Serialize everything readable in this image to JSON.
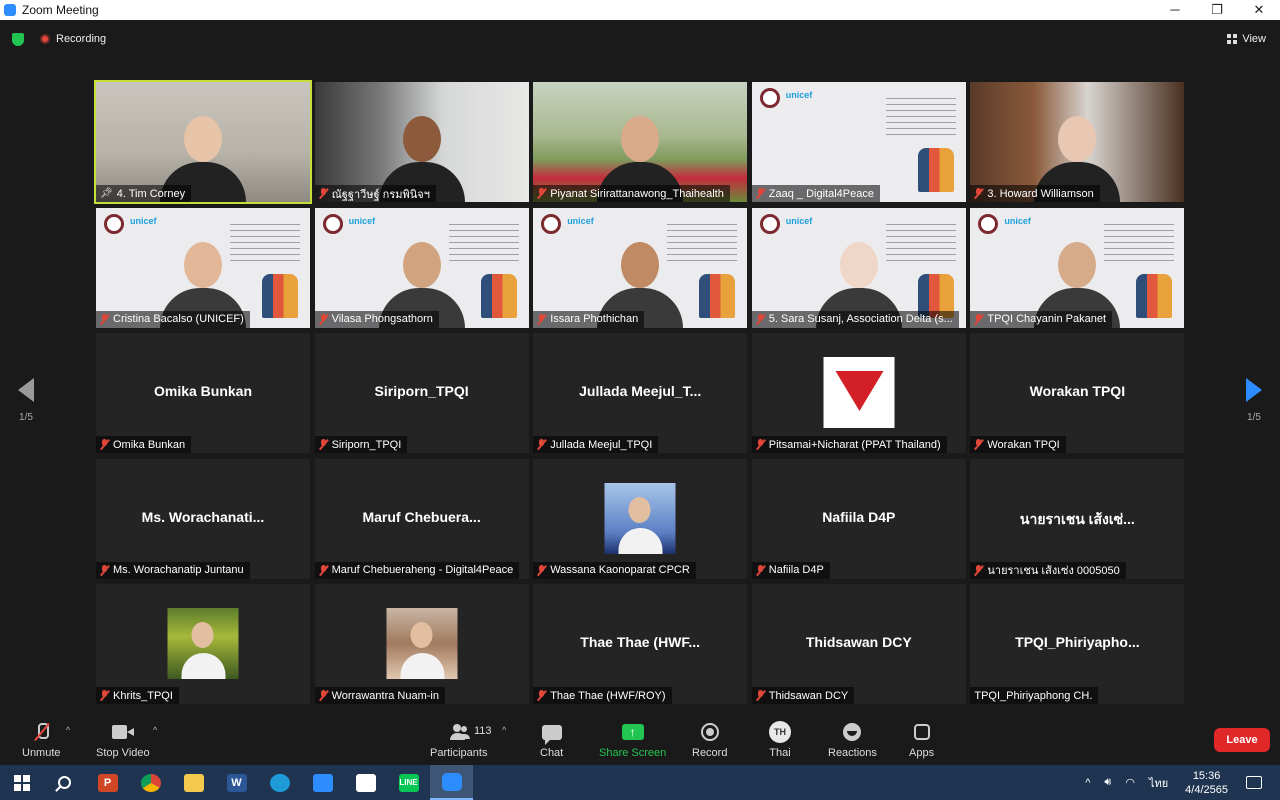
{
  "window": {
    "title": "Zoom Meeting",
    "minimize": "─",
    "restore": "❐",
    "close": "✕"
  },
  "topbar": {
    "recording_label": "Recording",
    "view_label": "View"
  },
  "colors": {
    "active_speaker": "#c6de3a",
    "muted": "#e0473a",
    "share": "#23c552",
    "leave": "#e02828",
    "accent": "#2d8cff"
  },
  "tiles": [
    {
      "label": "4. Tim Corney",
      "bigname": "",
      "video": "room",
      "active": true,
      "pinned": true,
      "muted": false
    },
    {
      "label": "ณัฐฐาวีษฐ์ กรมพินิจฯ",
      "bigname": "",
      "video": "office",
      "muted": true
    },
    {
      "label": "Piyanat Sirirattanawong_Thaihealth",
      "bigname": "",
      "video": "outdoor",
      "muted": true
    },
    {
      "label": "Zaaq _ Digital4Peace",
      "bigname": "",
      "video": "slide",
      "muted": true
    },
    {
      "label": "3. Howard Williamson",
      "bigname": "",
      "video": "books",
      "muted": true
    },
    {
      "label": "Cristina Bacalso (UNICEF)",
      "bigname": "",
      "video": "slide-person",
      "muted": true
    },
    {
      "label": "Vilasa Phongsathorn",
      "bigname": "",
      "video": "slide-person",
      "muted": true
    },
    {
      "label": "Issara Phothichan",
      "bigname": "",
      "video": "slide-person",
      "muted": true
    },
    {
      "label": "5. Sara Susanj, Association Delta (s...",
      "bigname": "",
      "video": "slide-person",
      "muted": true
    },
    {
      "label": "TPQI Chayanin Pakanet",
      "bigname": "",
      "video": "slide-person",
      "muted": true
    },
    {
      "label": "Omika Bunkan",
      "bigname": "Omika Bunkan",
      "video": "none",
      "muted": true
    },
    {
      "label": "Siriporn_TPQI",
      "bigname": "Siriporn_TPQI",
      "video": "none",
      "muted": true
    },
    {
      "label": "Jullada Meejul_TPQI",
      "bigname": "Jullada  Meejul_T...",
      "video": "none",
      "muted": true
    },
    {
      "label": "Pitsamai+Nicharat (PPAT Thailand)",
      "bigname": "",
      "video": "ppat",
      "muted": true
    },
    {
      "label": "Worakan TPQI",
      "bigname": "Worakan TPQI",
      "video": "none",
      "muted": true
    },
    {
      "label": "Ms. Worachanatip Juntanu",
      "bigname": "Ms.  Worachanati...",
      "video": "none",
      "muted": true
    },
    {
      "label": "Maruf Chebueraheng - Digital4Peace",
      "bigname": "Maruf  Chebuera...",
      "video": "none",
      "muted": true
    },
    {
      "label": "Wassana Kaonoparat CPCR",
      "bigname": "",
      "video": "photo-blue",
      "muted": true
    },
    {
      "label": "Nafiila D4P",
      "bigname": "Nafiila D4P",
      "video": "none",
      "muted": true
    },
    {
      "label": "นายราเชน  เส้งเซ่ง 0005050",
      "bigname": "นายราเชน  เส้งเซ่...",
      "video": "none",
      "muted": true
    },
    {
      "label": "Khrits_TPQI",
      "bigname": "",
      "video": "photo-green",
      "muted": true
    },
    {
      "label": "Worrawantra Nuam-in",
      "bigname": "",
      "video": "photo-warm",
      "muted": true
    },
    {
      "label": "Thae Thae (HWF/ROY)",
      "bigname": "Thae Thae  (HWF...",
      "video": "none",
      "muted": true
    },
    {
      "label": "Thidsawan DCY",
      "bigname": "Thidsawan DCY",
      "video": "none",
      "muted": true
    },
    {
      "label": "TPQI_Phiriyaphong CH.",
      "bigname": "TPQI_Phiriyapho...",
      "video": "none",
      "muted": false
    }
  ],
  "pager": {
    "left": "1/5",
    "right": "1/5"
  },
  "toolbar": {
    "unmute": "Unmute",
    "stop_video": "Stop Video",
    "participants": "Participants",
    "participant_count": "113",
    "chat": "Chat",
    "share_screen": "Share Screen",
    "record": "Record",
    "language": "Thai",
    "language_badge": "TH",
    "reactions": "Reactions",
    "apps": "Apps",
    "leave": "Leave"
  },
  "taskbar": {
    "icons": [
      "windows-start-icon",
      "search-icon",
      "powerpoint-icon",
      "chrome-icon",
      "file-explorer-icon",
      "word-icon",
      "edge-icon",
      "mail-icon",
      "store-icon",
      "line-icon",
      "zoom-icon"
    ],
    "tray_lang": "ไทย",
    "time": "15:36",
    "date": "4/4/2565"
  }
}
